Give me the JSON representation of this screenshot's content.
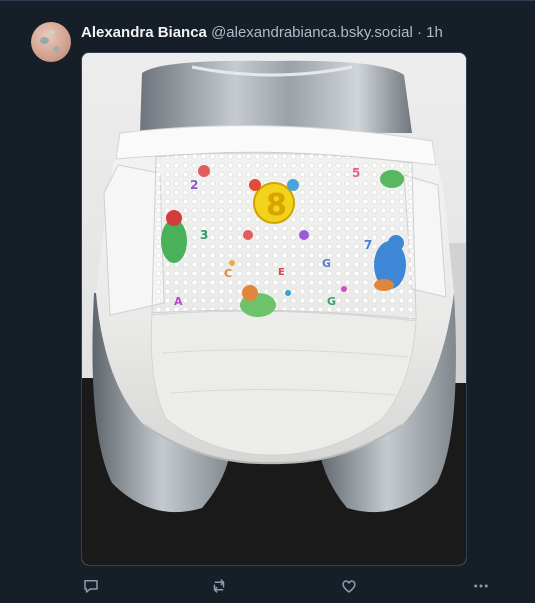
{
  "post": {
    "author_name": "Alexandra Bianca",
    "author_handle": "@alexandrabianca.bsky.social",
    "separator": "·",
    "time": "1h"
  },
  "media": {
    "image_alt": "Photo of a white diaper with colorful alphabet and animal print on a silver mannequin"
  },
  "actions": {
    "reply_icon": "reply-icon",
    "repost_icon": "repost-icon",
    "like_icon": "heart-icon",
    "more_icon": "more-icon"
  },
  "colors": {
    "background": "#161e27",
    "name_text": "#f1f3f5",
    "secondary_text": "#aebbc9",
    "border": "#2e4052"
  }
}
